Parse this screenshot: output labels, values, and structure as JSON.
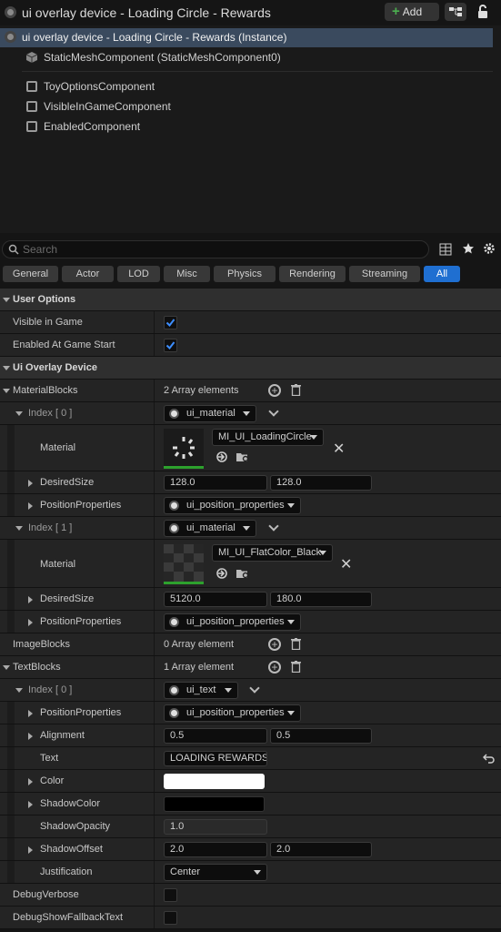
{
  "header": {
    "title": "ui overlay device - Loading Circle - Rewards",
    "add_label": "Add"
  },
  "components": {
    "instance": "ui overlay device - Loading Circle - Rewards (Instance)",
    "static_mesh": "StaticMeshComponent (StaticMeshComponent0)",
    "items": [
      "ToyOptionsComponent",
      "VisibleInGameComponent",
      "EnabledComponent"
    ]
  },
  "search": {
    "placeholder": "Search"
  },
  "tabs": [
    "General",
    "Actor",
    "LOD",
    "Misc",
    "Physics",
    "Rendering",
    "Streaming",
    "All"
  ],
  "user_options": {
    "section": "User Options",
    "visible_in_game": "Visible in Game",
    "enabled_at_start": "Enabled At Game Start"
  },
  "device": {
    "section": "Ui Overlay Device",
    "material_blocks": "MaterialBlocks",
    "material_blocks_count": "2 Array elements",
    "index0": "Index [ 0 ]",
    "index1": "Index [ 1 ]",
    "ui_material": "ui_material",
    "material": "Material",
    "material0": "MI_UI_LoadingCircle",
    "material1": "MI_UI_FlatColor_Black",
    "desired_size": "DesiredSize",
    "size0_x": "128.0",
    "size0_y": "128.0",
    "size1_x": "5120.0",
    "size1_y": "180.0",
    "position_properties": "PositionProperties",
    "ui_position_properties": "ui_position_properties",
    "image_blocks": "ImageBlocks",
    "image_blocks_count": "0 Array element",
    "text_blocks": "TextBlocks",
    "text_blocks_count": "1 Array element",
    "ui_text": "ui_text",
    "alignment": "Alignment",
    "align_x": "0.5",
    "align_y": "0.5",
    "text": "Text",
    "text_value": "LOADING REWARDS",
    "color": "Color",
    "shadow_color": "ShadowColor",
    "shadow_opacity": "ShadowOpacity",
    "shadow_opacity_value": "1.0",
    "shadow_offset": "ShadowOffset",
    "shadow_x": "2.0",
    "shadow_y": "2.0",
    "justification": "Justification",
    "justification_value": "Center",
    "debug_verbose": "DebugVerbose",
    "debug_fallback": "DebugShowFallbackText"
  },
  "colors": {
    "accent": "#1f6fd1",
    "color_value": "#ffffff",
    "shadow_color_value": "#000000"
  }
}
